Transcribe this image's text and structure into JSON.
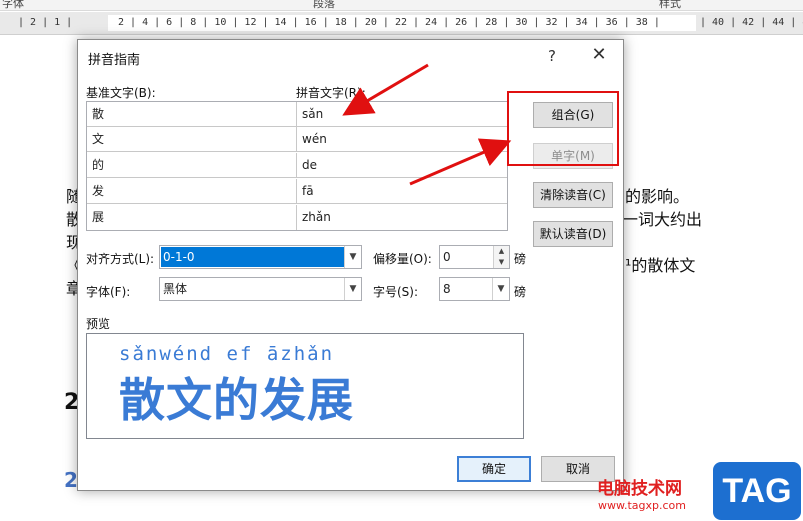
{
  "ribbon": {
    "labels": [
      "字体",
      "段落",
      "样式"
    ]
  },
  "ruler": {
    "left_text": "| 2 | 1 |",
    "mid_text": "2 | 4 | 6 | 8 | 10 | 12 | 14 | 16 | 18 | 20 | 22 | 24 | 26 | 28 | 30 | 32 | 34 | 36 | 38 |",
    "right_text": "| 40 | 42 | 44 | 46 |"
  },
  "document": {
    "lines": [
      {
        "left": "随",
        "right": "的影响。"
      },
      {
        "left": "散",
        "right": "一词大约出"
      },
      {
        "left": "现",
        "right": ""
      },
      {
        "left": "《",
        "right": "¹的散体文"
      },
      {
        "left": "章",
        "right": ""
      }
    ],
    "heading1_prefix": "2",
    "heading2_prefix": "2"
  },
  "dialog": {
    "title": "拼音指南",
    "help": "?",
    "close": "✕",
    "base_label": "基准文字(B):",
    "ruby_label": "拼音文字(R):",
    "rows": [
      {
        "base": "散",
        "ruby": "sǎn"
      },
      {
        "base": "文",
        "ruby": "wén"
      },
      {
        "base": "的",
        "ruby": "de"
      },
      {
        "base": "发",
        "ruby": "fā"
      },
      {
        "base": "展",
        "ruby": "zhǎn"
      }
    ],
    "buttons": {
      "group": "组合(G)",
      "mono": "单字(M)",
      "clear": "清除读音(C)",
      "default": "默认读音(D)",
      "ok": "确定",
      "cancel": "取消"
    },
    "align_label": "对齐方式(L):",
    "align_value": "0-1-0",
    "offset_label": "偏移量(O):",
    "offset_value": "0",
    "offset_unit": "磅",
    "font_label": "字体(F):",
    "font_value": "黑体",
    "size_label": "字号(S):",
    "size_value": "8",
    "size_unit": "磅",
    "preview_label": "预览",
    "preview_pinyin": "sǎnwénd ef āzhǎn",
    "preview_text": "散文的发展"
  },
  "watermark": {
    "site_cn": "电脑技术网",
    "url": "www.tagxp.com",
    "badge": "TAG"
  },
  "colors": {
    "accent": "#3a7bd5",
    "highlight": "#e01010",
    "selection": "#0078d7"
  }
}
